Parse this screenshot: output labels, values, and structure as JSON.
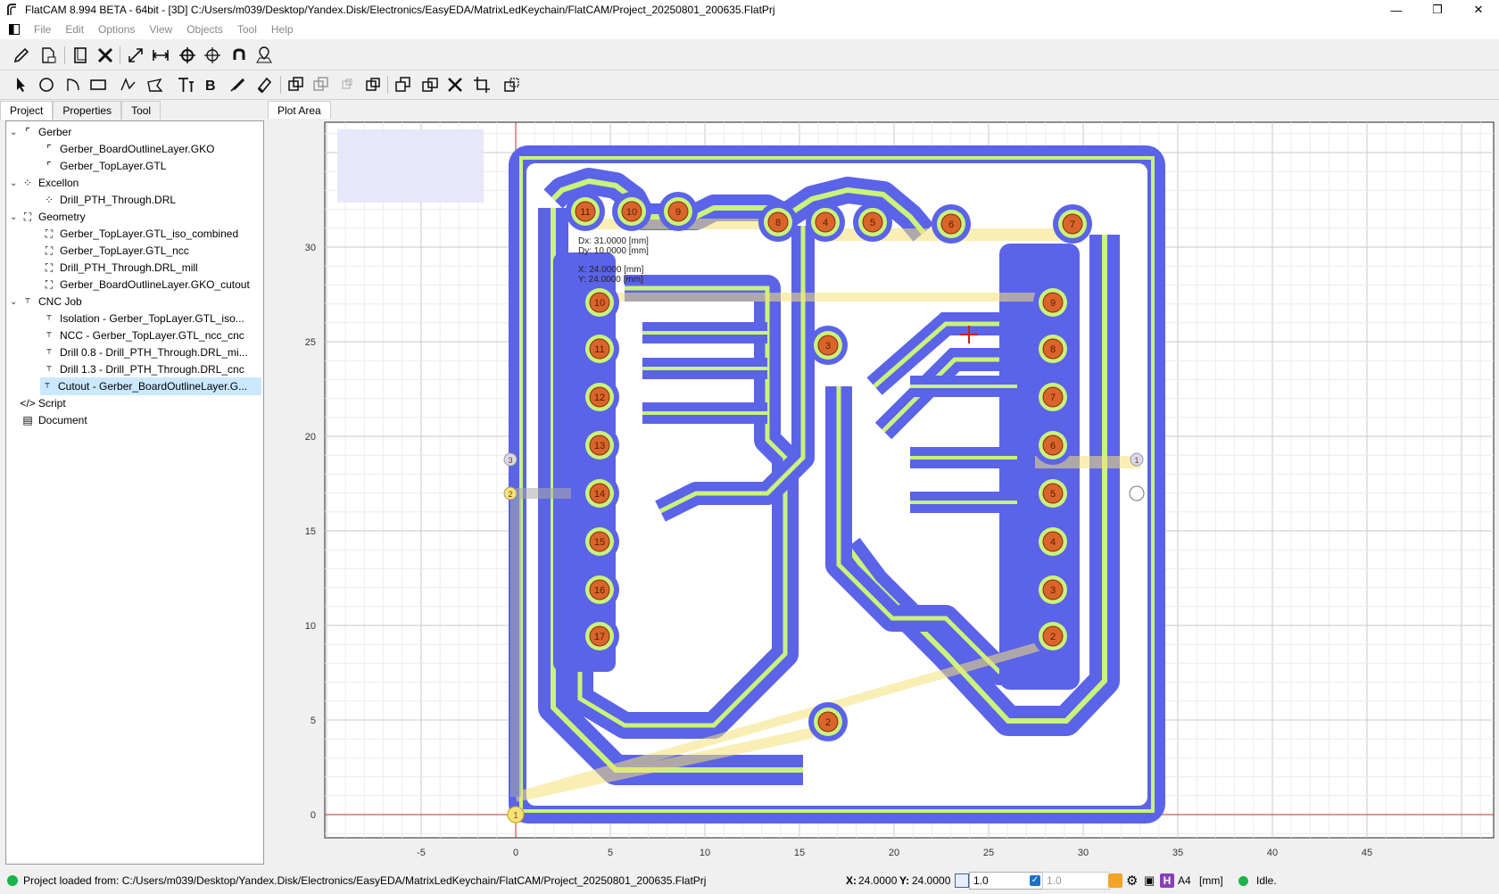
{
  "window": {
    "title": "FlatCAM 8.994 BETA - 64bit - [3D]   C:/Users/m039/Desktop/Yandex.Disk/Electronics/EasyEDA/MatrixLedKeychain/FlatCAM/Project_20250801_200635.FlatPrj",
    "minimize": "—",
    "restore": "❐",
    "close": "✕"
  },
  "menu": [
    "File",
    "Edit",
    "Options",
    "View",
    "Objects",
    "Tool",
    "Help"
  ],
  "tabs": [
    "Project",
    "Properties",
    "Tool"
  ],
  "tree": {
    "gerber": "Gerber",
    "gerber_items": [
      "Gerber_BoardOutlineLayer.GKO",
      "Gerber_TopLayer.GTL"
    ],
    "excellon": "Excellon",
    "excellon_items": [
      "Drill_PTH_Through.DRL"
    ],
    "geometry": "Geometry",
    "geometry_items": [
      "Gerber_TopLayer.GTL_iso_combined",
      "Gerber_TopLayer.GTL_ncc",
      "Drill_PTH_Through.DRL_mill",
      "Gerber_BoardOutlineLayer.GKO_cutout"
    ],
    "cnc": "CNC Job",
    "cnc_items": [
      "Isolation - Gerber_TopLayer.GTL_iso...",
      "NCC - Gerber_TopLayer.GTL_ncc_cnc",
      "Drill 0.8 - Drill_PTH_Through.DRL_mi...",
      "Drill 1.3 - Drill_PTH_Through.DRL_cnc",
      "Cutout - Gerber_BoardOutlineLayer.G..."
    ],
    "script": "Script",
    "document": "Document"
  },
  "plot": {
    "tab": "Plot Area",
    "readout": {
      "dx": "Dx:    31.0000 [mm]",
      "dy": "Dy:    10.0000 [mm]",
      "x": "X:      24.0000 [mm]",
      "y": "Y:      24.0000 [mm]"
    },
    "x_ticks": [
      "-5",
      "0",
      "5",
      "10",
      "15",
      "20",
      "25",
      "30",
      "35",
      "40",
      "45"
    ],
    "y_ticks": [
      "0",
      "5",
      "10",
      "15",
      "20",
      "25",
      "30"
    ]
  },
  "status": {
    "message": "Project loaded from: C:/Users/m039/Desktop/Yandex.Disk/Electronics/EasyEDA/MatrixLedKeychain/FlatCAM/Project_20250801_200635.FlatPrj",
    "x_label": "X:",
    "x_value": "24.0000",
    "y_label": "Y:",
    "y_value": "24.0000",
    "grid_value": "1.0",
    "grid_value2": "1.0",
    "page": "A4",
    "units": "[mm]",
    "state": "Idle.",
    "h_badge": "H"
  },
  "colors": {
    "outline": "#5b63e8",
    "trace": "#c9f37a",
    "pad": "#d9652b",
    "travel": "#f5e27a"
  },
  "icons": [
    "pencil-icon",
    "save-icon",
    "new-icon",
    "delete-icon",
    "zoom-fit-icon",
    "distance-icon",
    "crosshair-icon",
    "magnet-icon",
    "location-icon",
    "pointer-icon",
    "circle-icon",
    "arc-icon",
    "rect-icon",
    "path-icon",
    "polygon-icon",
    "text-icon",
    "bold-icon",
    "paint-icon",
    "eraser-icon"
  ]
}
